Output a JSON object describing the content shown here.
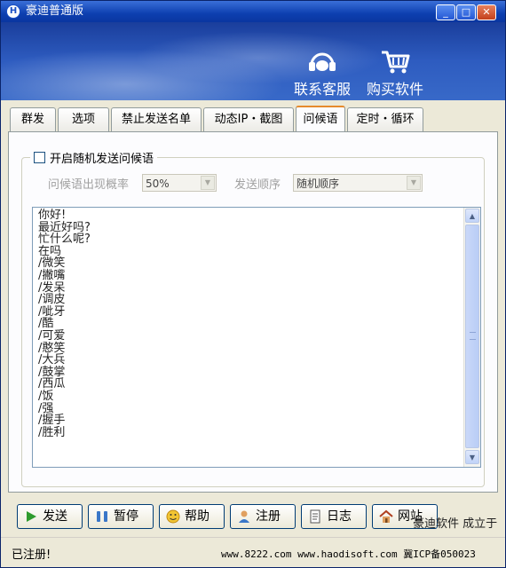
{
  "window": {
    "title": "豪迪普通版",
    "controls": {
      "minimize": "_",
      "maximize": "□",
      "close": "✕"
    }
  },
  "banner": {
    "contact": {
      "label": "联系客服",
      "icon": "headset-icon"
    },
    "buy": {
      "label": "购买软件",
      "icon": "cart-icon"
    }
  },
  "tabs": [
    {
      "label": "群发"
    },
    {
      "label": "选项"
    },
    {
      "label": "禁止发送名单"
    },
    {
      "label": "动态IP・截图"
    },
    {
      "label": "问候语"
    },
    {
      "label": "定时・循环"
    }
  ],
  "active_tab": "问候语",
  "greeting": {
    "enable_label": "开启随机发送问候语",
    "enabled": false,
    "probability_label": "问候语出现概率",
    "probability_value": "50%",
    "order_label": "发送顺序",
    "order_value": "随机顺序",
    "lines": [
      "你好!",
      "最近好吗?",
      "忙什么呢?",
      "在吗",
      "/微笑",
      "/撇嘴",
      "/发呆",
      "/调皮",
      "/呲牙",
      "/酷",
      "/可爱",
      "/憨笑",
      "/大兵",
      "/鼓掌",
      "/西瓜",
      "/饭",
      "/强",
      "/握手",
      "/胜利"
    ]
  },
  "buttons": {
    "send": "发送",
    "pause": "暂停",
    "help": "帮助",
    "register": "注册",
    "log": "日志",
    "website": "网站"
  },
  "overlay": "豪迪软件  成立于",
  "status": {
    "left": "已注册!",
    "right": "www.8222.com  www.haodisoft.com  冀ICP备050023"
  },
  "colors": {
    "titlebar": "#0d3fb0",
    "active_tab_accent": "#e68b2c",
    "banner": "#2e5cc0"
  }
}
